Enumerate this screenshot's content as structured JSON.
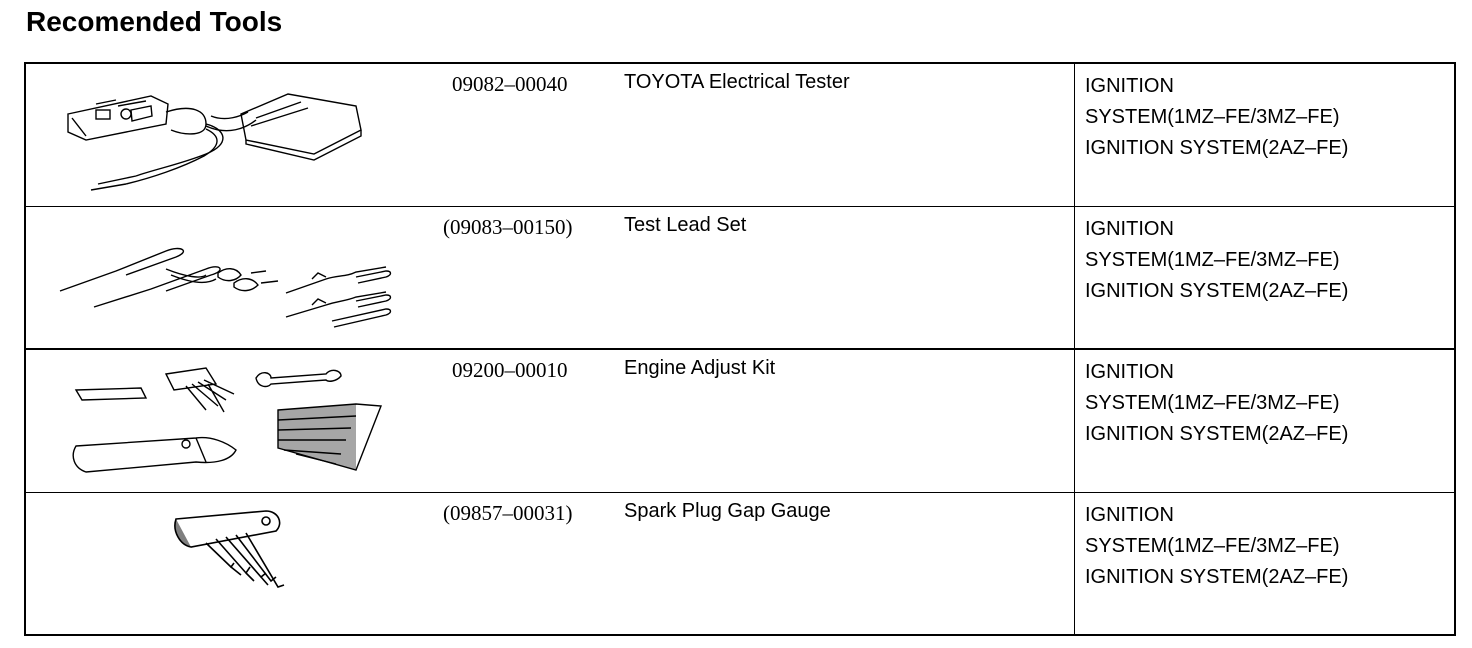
{
  "page": {
    "title": "Recomended Tools"
  },
  "tools": [
    {
      "part_no": "09082–00040",
      "name": "TOYOTA Electrical Tester",
      "illustration_icon": "electrical-tester-illustration",
      "usage": [
        "IGNITION",
        "SYSTEM(1MZ–FE/3MZ–FE)",
        "IGNITION  SYSTEM(2AZ–FE)"
      ]
    },
    {
      "part_no": "(09083–00150)",
      "name": "Test Lead Set",
      "illustration_icon": "test-lead-set-illustration",
      "usage": [
        "IGNITION",
        "SYSTEM(1MZ–FE/3MZ–FE)",
        "IGNITION  SYSTEM(2AZ–FE)"
      ]
    },
    {
      "part_no": "09200–00010",
      "name": "Engine Adjust Kit",
      "illustration_icon": "engine-adjust-kit-illustration",
      "usage": [
        "IGNITION",
        "SYSTEM(1MZ–FE/3MZ–FE)",
        "IGNITION  SYSTEM(2AZ–FE)"
      ]
    },
    {
      "part_no": "(09857–00031)",
      "name": "Spark Plug Gap Gauge",
      "illustration_icon": "spark-plug-gap-gauge-illustration",
      "usage": [
        "IGNITION",
        "SYSTEM(1MZ–FE/3MZ–FE)",
        "IGNITION  SYSTEM(2AZ–FE)"
      ]
    }
  ]
}
